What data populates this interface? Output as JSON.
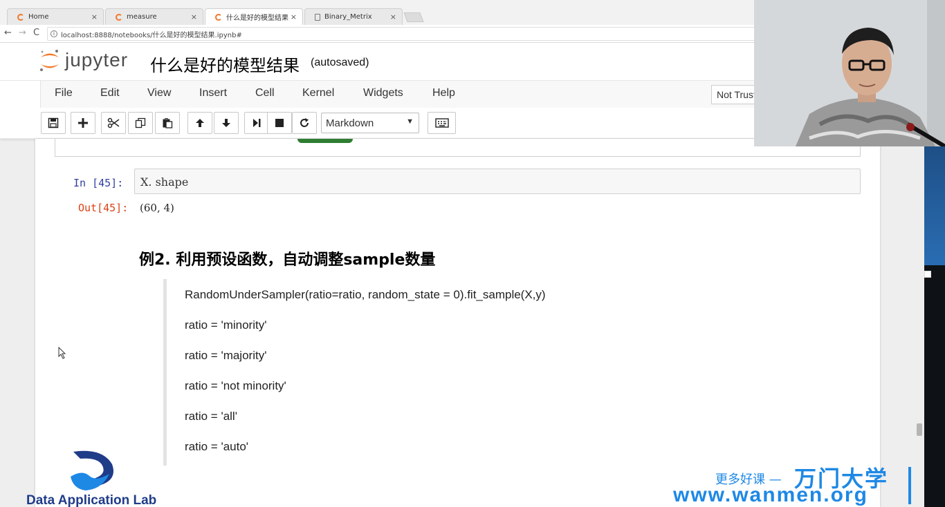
{
  "browser": {
    "tabs": [
      {
        "label": "Home",
        "active": false
      },
      {
        "label": "measure",
        "active": false
      },
      {
        "label": "什么是好的模型结果",
        "active": true
      },
      {
        "label": "Binary_Metrix",
        "active": false
      }
    ],
    "close_glyph": "×",
    "url": "localhost:8888/notebooks/什么是好的模型结果.ipynb#",
    "back_icon": "←",
    "forward_icon": "→",
    "reload_icon": "C",
    "info_icon": "i"
  },
  "jupyter": {
    "logo_text": "jupyter",
    "notebook_title": "什么是好的模型结果",
    "save_status": "(autosaved)",
    "trust_label": "Not Trusted",
    "menu": [
      "File",
      "Edit",
      "View",
      "Insert",
      "Cell",
      "Kernel",
      "Widgets",
      "Help"
    ],
    "toolbar": {
      "icons": [
        "save-icon",
        "plus-icon",
        "cut-icon",
        "copy-icon",
        "paste-icon",
        "arrow-up-icon",
        "arrow-down-icon",
        "run-icon",
        "stop-icon",
        "restart-icon",
        "keyboard-icon"
      ],
      "cell_type": "Markdown",
      "cell_type_arrow": "▼"
    }
  },
  "notebook": {
    "in_prompt": "In  [45]:",
    "input_code": "X. shape",
    "out_prompt": "Out[45]:",
    "output_value": "(60,  4)",
    "heading": "例2. 利用预设函数，自动调整sample数量",
    "quote_lines": [
      "RandomUnderSampler(ratio=ratio, random_state = 0).fit_sample(X,y)",
      "ratio = 'minority'",
      "ratio = 'majority'",
      "ratio = 'not minority'",
      "ratio = 'all'",
      "ratio = 'auto'"
    ]
  },
  "watermark": {
    "lab_name": "Data Application Lab",
    "slogan": "更多好课 —",
    "brand": "万门大学",
    "url": "www.wanmen.org"
  },
  "colors": {
    "jupyter_orange": "#f37726",
    "in_prompt": "#303f9f",
    "out_prompt": "#d84315",
    "watermark_blue": "#1e88e5"
  }
}
